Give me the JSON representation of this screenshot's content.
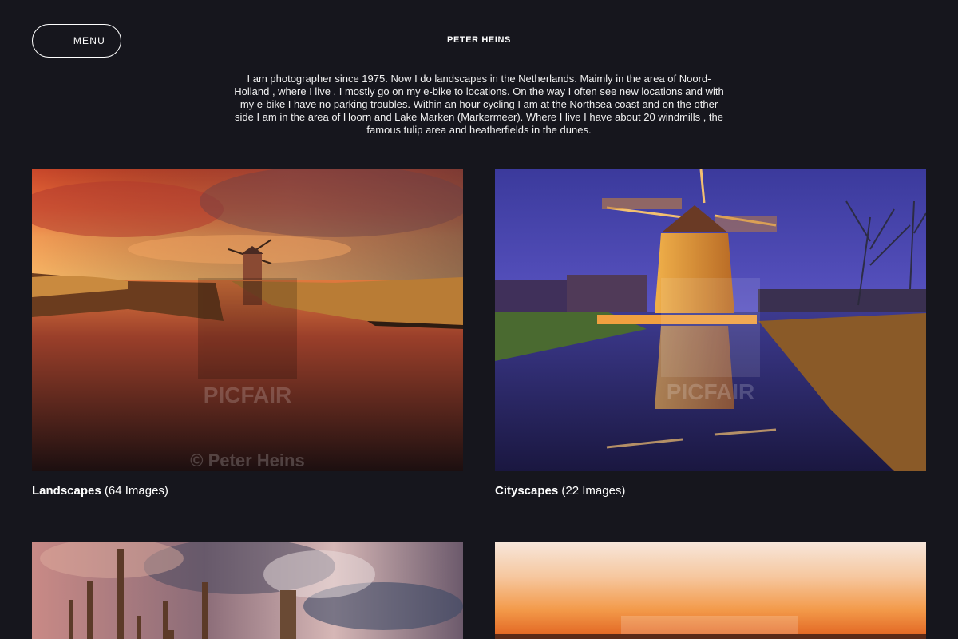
{
  "header": {
    "menu_label": "MENU",
    "site_title": "PETER HEINS"
  },
  "intro": {
    "text": "I am photographer since 1975. Now I do landscapes in the Netherlands. Maimly in the area of Noord-Holland , where I live . I mostly go on my e-bike to locations. On the way I often see new locations and with my e-bike I have no parking troubles. Within an hour cycling I am at the Northsea coast and on the other side I am in the area of Hoorn and Lake Marken (Markermeer). Where I live I have about 20 windmills , the famous tulip area and heatherfields in the dunes."
  },
  "galleries": [
    {
      "title": "Landscapes",
      "count": "(64 Images)",
      "watermark_brand": "PICFAIR",
      "watermark_credit": "© Peter Heins"
    },
    {
      "title": "Cityscapes",
      "count": "(22 Images)",
      "watermark_brand": "PICFAIR"
    },
    {
      "title": "",
      "count": ""
    },
    {
      "title": "",
      "count": ""
    }
  ],
  "colors": {
    "background": "#16161d",
    "text": "#ffffff"
  }
}
